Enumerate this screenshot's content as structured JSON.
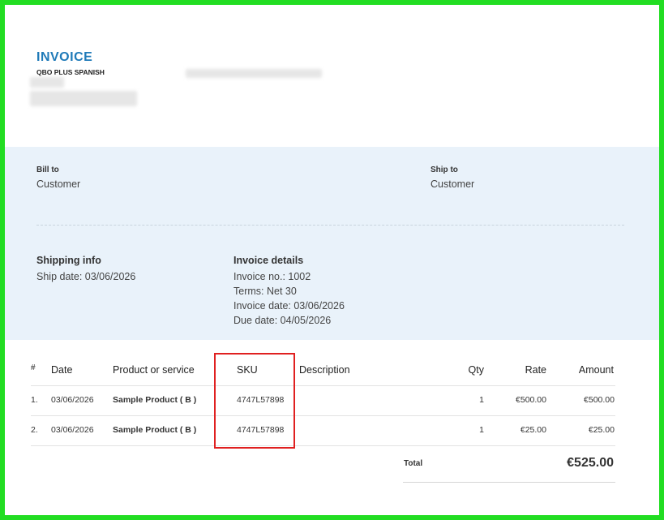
{
  "header": {
    "title": "INVOICE",
    "company": "QBO PLUS SPANISH"
  },
  "bill_to": {
    "label": "Bill to",
    "value": "Customer"
  },
  "ship_to": {
    "label": "Ship to",
    "value": "Customer"
  },
  "shipping_info": {
    "label": "Shipping info",
    "ship_date": "Ship date: 03/06/2026"
  },
  "invoice_details": {
    "label": "Invoice details",
    "invoice_no": "Invoice no.: 1002",
    "terms": "Terms: Net 30",
    "invoice_date": "Invoice date: 03/06/2026",
    "due_date": "Due date: 04/05/2026"
  },
  "table": {
    "columns": {
      "num": "#",
      "date": "Date",
      "product": "Product or service",
      "sku": "SKU",
      "description": "Description",
      "qty": "Qty",
      "rate": "Rate",
      "amount": "Amount"
    },
    "rows": [
      {
        "num": "1.",
        "date": "03/06/2026",
        "product": "Sample Product ( B )",
        "sku": "4747L57898",
        "description": "",
        "qty": "1",
        "rate": "€500.00",
        "amount": "€500.00"
      },
      {
        "num": "2.",
        "date": "03/06/2026",
        "product": "Sample Product ( B )",
        "sku": "4747L57898",
        "description": "",
        "qty": "1",
        "rate": "€25.00",
        "amount": "€25.00"
      }
    ]
  },
  "total": {
    "label": "Total",
    "value": "€525.00"
  },
  "colors": {
    "accent": "#1f7ab8",
    "band": "#e9f2fa",
    "frame": "#22dd22",
    "highlight": "#e02020"
  }
}
